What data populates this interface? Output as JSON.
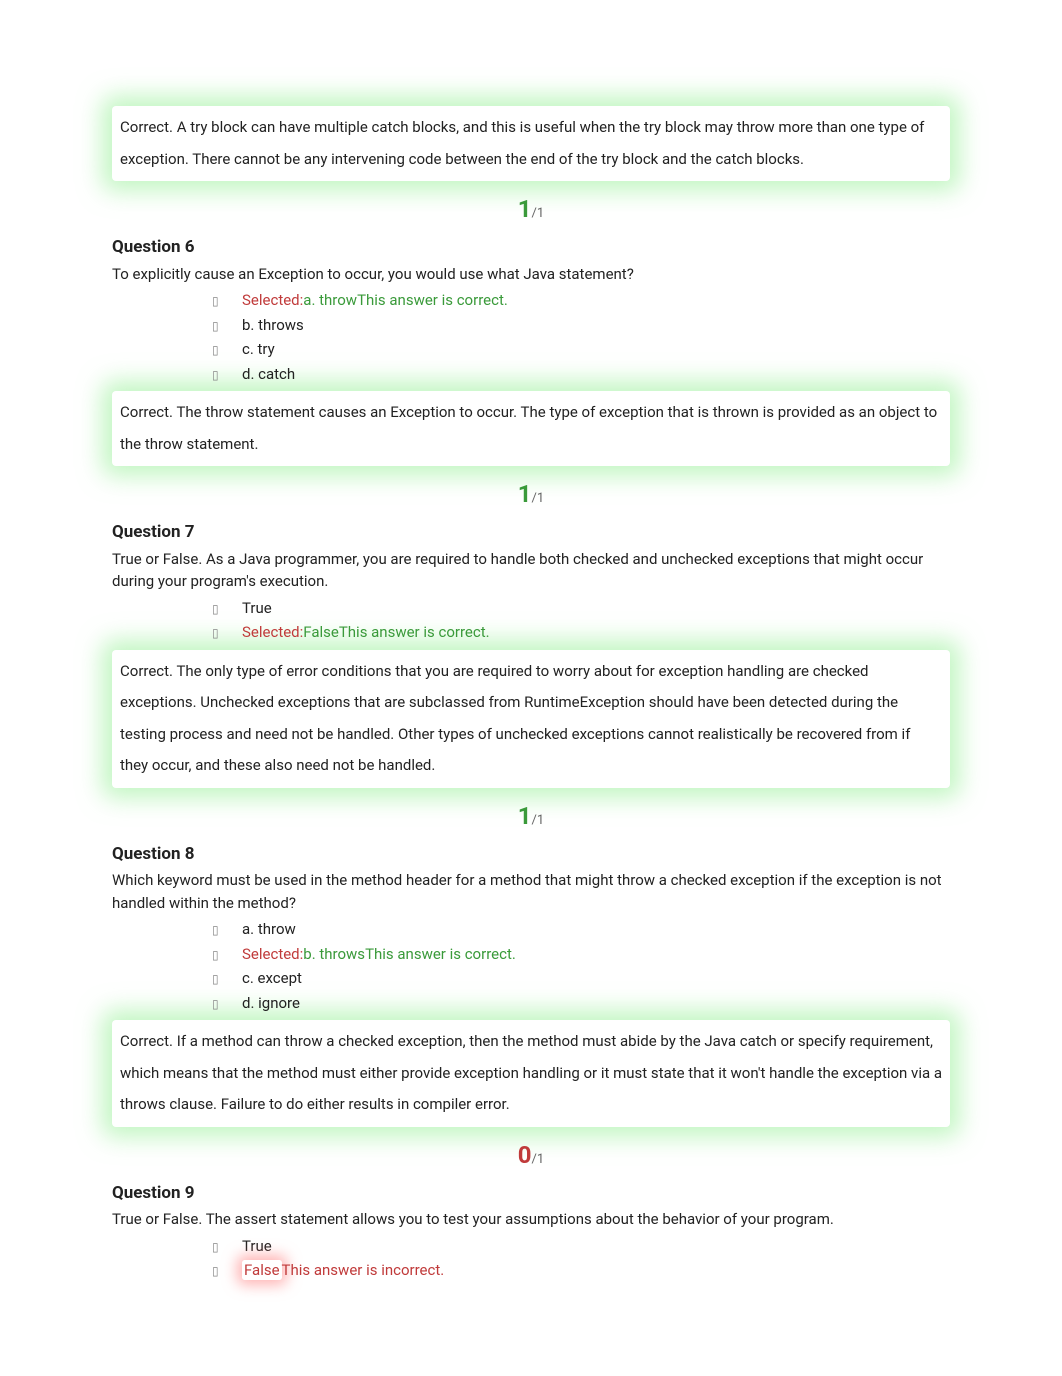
{
  "q5": {
    "feedback": "Correct. A try block can have multiple catch blocks, and this is useful when the try block may throw more than one type of exception. There cannot be any intervening code between the end of the try block and the catch blocks.",
    "score_earned": "1",
    "score_max": "/1"
  },
  "q6": {
    "title": "Question 6",
    "prompt": "To explicitly cause an Exception to occur, you would use what Java statement?",
    "a_sel": "Selected:",
    "a_text": "a. throw",
    "a_note": "This answer is correct.",
    "b_text": "b. throws",
    "c_text": "c. try",
    "d_text": "d. catch",
    "feedback": "Correct. The throw statement causes an Exception to occur. The type of exception that is thrown is provided as an object to the throw statement.",
    "score_earned": "1",
    "score_max": "/1"
  },
  "q7": {
    "title": "Question 7",
    "prompt": "True or False. As a Java programmer, you are required to handle both checked and unchecked exceptions that might occur during your program's execution.",
    "a_text": "True",
    "b_sel": "Selected:",
    "b_text": "False",
    "b_note": "This answer is correct.",
    "feedback": "Correct. The only type of error conditions that you are required to worry about for exception handling are checked exceptions. Unchecked exceptions that are subclassed from RuntimeException should have been detected during the testing process and need not be handled. Other types of unchecked exceptions cannot realistically be recovered from if they occur, and these also need not be handled.",
    "score_earned": "1",
    "score_max": "/1"
  },
  "q8": {
    "title": "Question 8",
    "prompt": "Which keyword must be used in the method header for a method that might throw a checked exception if the exception is not handled within the method?",
    "a_text": "a. throw",
    "b_sel": "Selected:",
    "b_text": "b. throws",
    "b_note": "This answer is correct.",
    "c_text": "c. except",
    "d_text": "d. ignore",
    "feedback": "Correct. If a method can throw a checked exception, then the method must abide by the Java catch or specify requirement, which means that the method must either provide exception handling or it must state that it won't handle the exception via a throws clause. Failure to do either results in compiler error.",
    "score_earned": "0",
    "score_max": "/1"
  },
  "q9": {
    "title": "Question 9",
    "prompt": "True or False. The assert statement allows you to test your assumptions about the behavior of your program.",
    "a_text": "True",
    "b_text": "False",
    "b_note": "This answer is incorrect."
  }
}
